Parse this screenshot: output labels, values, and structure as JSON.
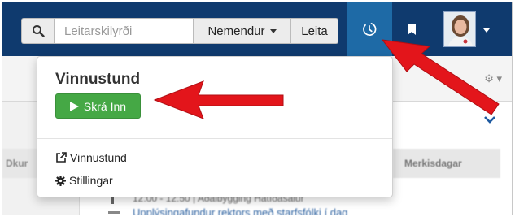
{
  "navbar": {
    "search": {
      "icon": "search-icon",
      "placeholder": "Leitarskilyrði"
    },
    "scope_dropdown": {
      "label": "Nemendur",
      "icon": "caret-down-icon"
    },
    "search_button": {
      "label": "Leita"
    },
    "clock": {
      "icon": "clock-icon"
    },
    "bookmark": {
      "icon": "bookmark-icon"
    },
    "user_menu": {
      "icon": "caret-down-icon"
    }
  },
  "background": {
    "left_header": "Dkur",
    "right_header": "Merkisdagar",
    "line1": "12:00 - 12:50 | Aðalbygging Hátíðasalur",
    "line2": "Upplýsingafundur rektors með starfsfólki í dag"
  },
  "dropdown": {
    "title": "Vinnustund",
    "checkin_label": "Skrá Inn",
    "items": [
      {
        "label": "Vinnustund",
        "icon": "external-link-icon"
      },
      {
        "label": "Stillingar",
        "icon": "gear-icon"
      }
    ]
  },
  "colors": {
    "navbar": "#0f3a6e",
    "active_tab": "#1e6aa6",
    "checkin_green": "#45a845",
    "arrow_red": "#e3151b"
  }
}
